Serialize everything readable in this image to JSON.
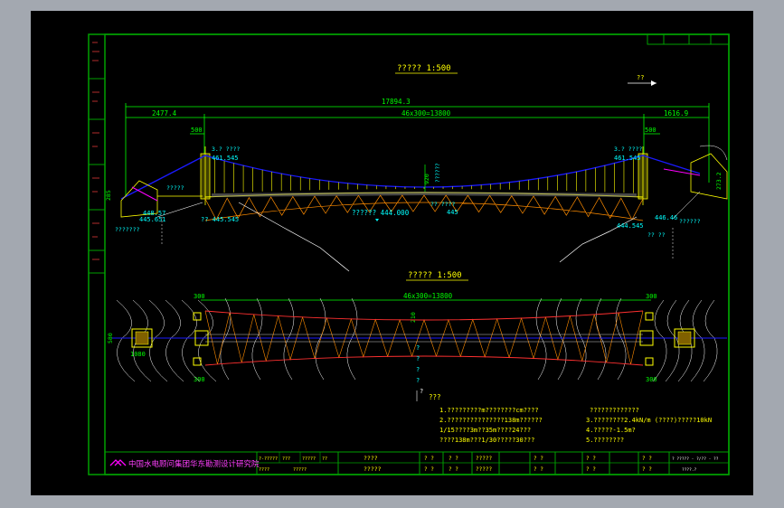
{
  "app": {
    "background": "#a3a8b0",
    "canvas_bg": "#000000"
  },
  "colors": {
    "frame": "#00a000",
    "dim": "#00ff00",
    "text_yellow": "#ffff00",
    "cable": "#1a1aff",
    "truss": "#ff8c00",
    "white": "#ffffff",
    "cyan": "#00ffff",
    "magenta": "#ff00ff"
  },
  "drawing": {
    "elevation_title": "?????  1:500",
    "plan_title": "?????  1:500",
    "total_span": "17894.3",
    "left_end": "2477.4",
    "main_span": "46x300=13800",
    "right_end": "1616.9",
    "left_500": "500",
    "right_500": "500",
    "left_top_label": "3.? ????",
    "left_top_elev": "461.545",
    "right_top_label": "3.? ????",
    "right_top_elev": "461.545",
    "sag": "920",
    "sag_note": "??????",
    "mid_label": "?? ????",
    "mid_elev": "445",
    "water_level": "??????  444.000",
    "left_elev_1": "445.651",
    "left_elev_2": "?? 445.545",
    "left_mark": "448.57",
    "left_note": "?????",
    "left_note2": "???????",
    "right_elev_1": "444.545",
    "right_elev_2": "446.46",
    "right_note": "??????",
    "right_note2": "?? ??",
    "left_285": "285",
    "right_dim": "273.2",
    "north": "??",
    "plan_main_span": "46x300=13800",
    "plan_300_tl": "300",
    "plan_300_bl": "300",
    "plan_300_tr": "300",
    "plan_300_br": "300",
    "plan_210": "210",
    "plan_580": "580",
    "plan_1080": "1080",
    "plan_vertical": "?\n?\n?\n?",
    "plan_water": "?",
    "notes_heading": "???",
    "notes": [
      "1.?????????m????????cm????",
      "2.???????????????138m??????",
      "  1/15????3m??35m????24???",
      "  ????138m???1/30?????30???"
    ],
    "notes_right": [
      "?????????????",
      "3.????????2.4kN/m (????)?????10kN",
      "4.?????-1.5m?",
      "5.????????"
    ]
  },
  "title_block": {
    "institute": "中国水电顾问集团华东勘测设计研究院",
    "c1a": "?-?????",
    "c1b": "???",
    "c1c": "?????",
    "c1d": "??",
    "c2a": "????",
    "c2b": "?????",
    "c3a": "????",
    "c3b": "?????",
    "c4a": "? ?",
    "c4b": "? ?",
    "c5a": "? ?",
    "c5b": "? ?",
    "c6a": "?????",
    "c6b": "?????",
    "c7a": "? ?",
    "c7b": "? ?",
    "c8a": "? ?",
    "c8b": "? ?",
    "c9a": "? ?",
    "c9b": "? ?",
    "num1": "? ????? - ?/?? - ??",
    "num2": "????.?"
  }
}
